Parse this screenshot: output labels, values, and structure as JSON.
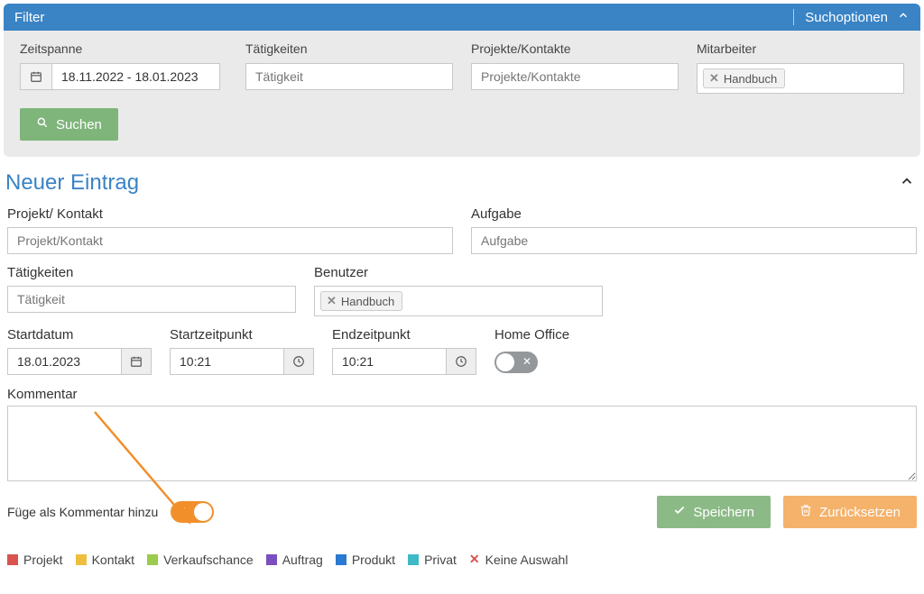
{
  "filter": {
    "title": "Filter",
    "suchoptionen": "Suchoptionen",
    "zeitspanne_label": "Zeitspanne",
    "zeitspanne_value": "18.11.2022 - 18.01.2023",
    "taetigkeiten_label": "Tätigkeiten",
    "taetigkeiten_placeholder": "Tätigkeit",
    "projekte_label": "Projekte/Kontakte",
    "projekte_placeholder": "Projekte/Kontakte",
    "mitarbeiter_label": "Mitarbeiter",
    "mitarbeiter_tag": "Handbuch",
    "suchen": "Suchen"
  },
  "entry": {
    "title": "Neuer Eintrag",
    "projekt_label": "Projekt/ Kontakt",
    "projekt_placeholder": "Projekt/Kontakt",
    "aufgabe_label": "Aufgabe",
    "aufgabe_placeholder": "Aufgabe",
    "taetigkeiten_label": "Tätigkeiten",
    "taetigkeiten_placeholder": "Tätigkeit",
    "benutzer_label": "Benutzer",
    "benutzer_tag": "Handbuch",
    "startdatum_label": "Startdatum",
    "startdatum_value": "18.01.2023",
    "startzeit_label": "Startzeitpunkt",
    "startzeit_value": "10:21",
    "endzeit_label": "Endzeitpunkt",
    "endzeit_value": "10:21",
    "homeoffice_label": "Home Office",
    "kommentar_label": "Kommentar",
    "add_comment_label": "Füge als Kommentar hinzu",
    "speichern": "Speichern",
    "zuruecksetzen": "Zurücksetzen"
  },
  "legend": {
    "projekt": "Projekt",
    "kontakt": "Kontakt",
    "verkauf": "Verkaufschance",
    "auftrag": "Auftrag",
    "produkt": "Produkt",
    "privat": "Privat",
    "keine": "Keine Auswahl"
  }
}
